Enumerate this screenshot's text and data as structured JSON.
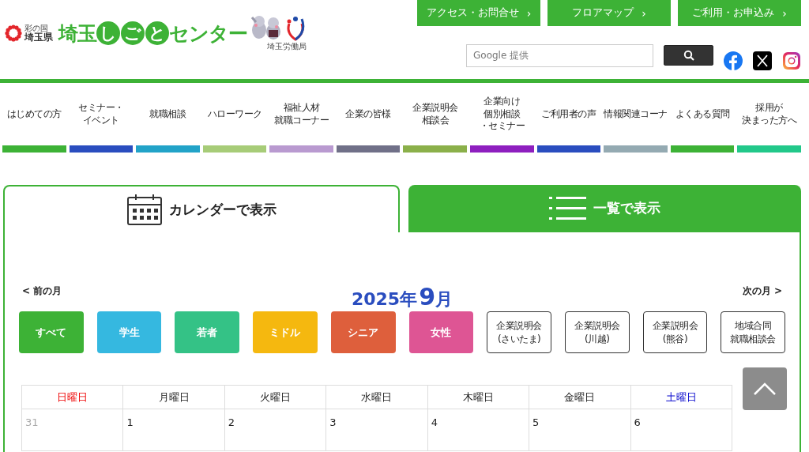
{
  "header": {
    "logo": {
      "region_small": "彩の国",
      "prefecture": "埼玉県",
      "title_parts": [
        {
          "text": "埼玉",
          "kind": "plain"
        },
        {
          "text": "しごと",
          "kind": "circled"
        },
        {
          "text": "センター",
          "kind": "plain"
        }
      ],
      "bureau": "埼玉労働局"
    },
    "top_links": [
      {
        "label": "アクセス・お問合せ",
        "arrow": "›"
      },
      {
        "label": "フロアマップ",
        "arrow": "›"
      },
      {
        "label": "ご利用・お申込み",
        "arrow": "›"
      }
    ],
    "search": {
      "placeholder": "Google 提供"
    }
  },
  "nav": [
    {
      "label": "はじめての方",
      "color": "#3db236"
    },
    {
      "lines": [
        "セミナー・",
        "イベント"
      ],
      "color": "#2a4dbf"
    },
    {
      "label": "就職相談",
      "color": "#22a3c8"
    },
    {
      "label": "ハローワーク",
      "color": "#a7cc78"
    },
    {
      "lines": [
        "福祉人材",
        "就職コーナー"
      ],
      "color": "#b99ad0"
    },
    {
      "label": "企業の皆様",
      "color": "#707088"
    },
    {
      "lines": [
        "企業説明会",
        "相談会"
      ],
      "color": "#8bb04a"
    },
    {
      "lines": [
        "企業向け",
        "個別相談",
        "・セミナー"
      ],
      "color": "#8e1fbf"
    },
    {
      "label": "ご利用者の声",
      "color": "#2a4dbf"
    },
    {
      "label": "情報関連コーナ",
      "color": "#94aab2"
    },
    {
      "label": "よくある質問",
      "color": "#3db236"
    },
    {
      "lines": [
        "採用が",
        "決まった方へ"
      ],
      "color": "#22c88a"
    }
  ],
  "view_tabs": [
    {
      "label": "カレンダーで表示",
      "kind": "calendar",
      "selected": true
    },
    {
      "label": "一覧で表示",
      "kind": "list",
      "selected": false
    }
  ],
  "month_nav": {
    "prev": "< 前の月",
    "next": "次の月 >",
    "year": "2025年",
    "month": "9",
    "month_suffix": "月"
  },
  "filters": [
    {
      "label": "すべて",
      "kind": "filled",
      "color": "#3db236"
    },
    {
      "label": "学生",
      "kind": "filled",
      "color": "#35b8e0"
    },
    {
      "label": "若者",
      "kind": "filled",
      "color": "#34c286"
    },
    {
      "label": "ミドル",
      "kind": "filled",
      "color": "#f5b80f"
    },
    {
      "label": "シニア",
      "kind": "filled",
      "color": "#de5f3c"
    },
    {
      "label": "女性",
      "kind": "filled",
      "color": "#de5594"
    },
    {
      "lines": [
        "企業説明会",
        "(さいたま)"
      ],
      "kind": "outline"
    },
    {
      "lines": [
        "企業説明会",
        "(川越)"
      ],
      "kind": "outline"
    },
    {
      "lines": [
        "企業説明会",
        "(熊谷)"
      ],
      "kind": "outline"
    },
    {
      "lines": [
        "地域合同",
        "就職相談会"
      ],
      "kind": "outline"
    }
  ],
  "calendar": {
    "weekdays": [
      {
        "label": "日曜日",
        "kind": "sunday"
      },
      {
        "label": "月曜日",
        "kind": "weekday"
      },
      {
        "label": "火曜日",
        "kind": "weekday"
      },
      {
        "label": "水曜日",
        "kind": "weekday"
      },
      {
        "label": "木曜日",
        "kind": "weekday"
      },
      {
        "label": "金曜日",
        "kind": "weekday"
      },
      {
        "label": "土曜日",
        "kind": "saturday"
      }
    ],
    "days": [
      {
        "label": "31",
        "outside": true
      },
      {
        "label": "1",
        "outside": false
      },
      {
        "label": "2",
        "outside": false
      },
      {
        "label": "3",
        "outside": false
      },
      {
        "label": "4",
        "outside": false
      },
      {
        "label": "5",
        "outside": false
      },
      {
        "label": "6",
        "outside": false
      }
    ]
  }
}
